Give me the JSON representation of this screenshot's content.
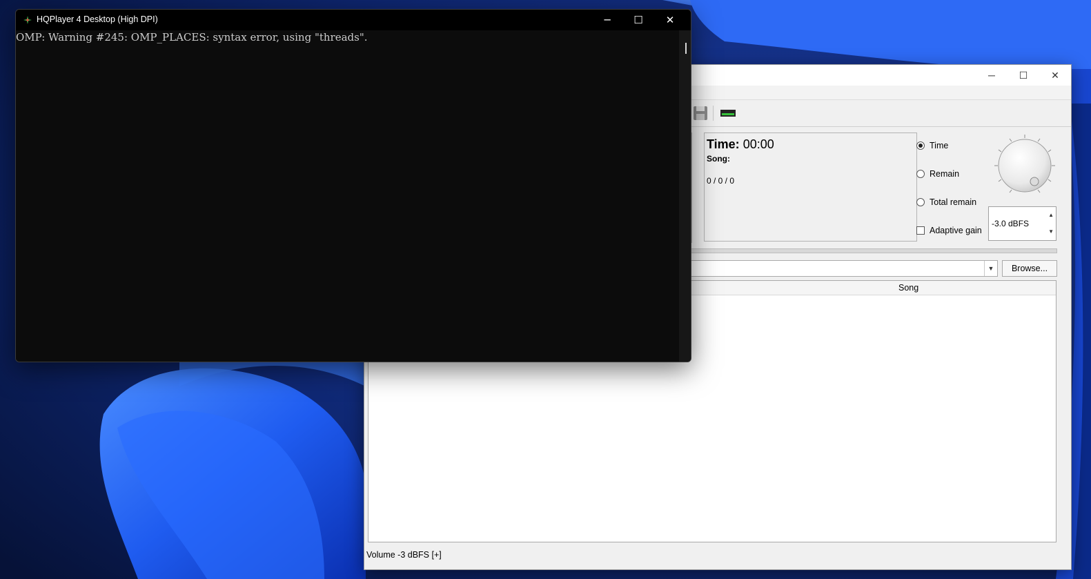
{
  "console": {
    "title": "HQPlayer 4 Desktop (High DPI)",
    "output": "OMP: Warning #245: OMP_PLACES: syntax error, using \"threads\".",
    "minimize": "─",
    "maximize": "☐",
    "close": "✕"
  },
  "main_window": {
    "minimize": "─",
    "maximize": "☐",
    "close": "✕",
    "info": {
      "time_label": "Time:",
      "time_value": "00:00",
      "song_label": "Song:",
      "counter": "0 / 0 / 0"
    },
    "display_mode": {
      "options": [
        "Time",
        "Remain",
        "Total remain"
      ],
      "selected": "Time"
    },
    "adaptive_gain_label": "Adaptive gain",
    "adaptive_gain_checked": false,
    "volume_spin": {
      "value": "-3.0 dBFS",
      "up": "▲",
      "down": "▼"
    },
    "combo_arrow": "▼",
    "browse_label": "Browse...",
    "playlist": {
      "columns": [
        "Song"
      ]
    },
    "status": "Volume -3 dBFS  [+]"
  },
  "colors": {
    "wallpaper_dark": "#0a1a4a",
    "wallpaper_blue": "#1f57e0",
    "console_bg": "#0c0c0c",
    "window_bg": "#f0f0f0"
  },
  "icons": [
    "save-icon",
    "device-icon",
    "knob-icon"
  ]
}
